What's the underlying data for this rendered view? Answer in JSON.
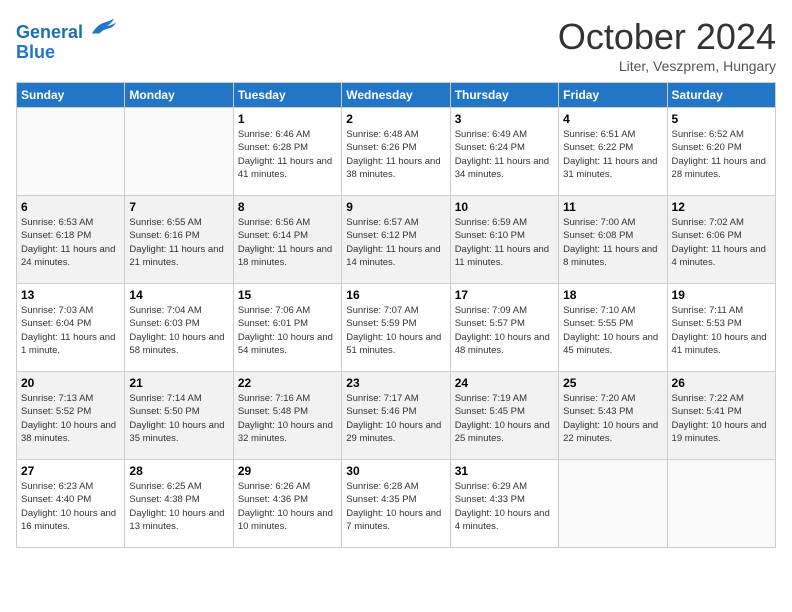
{
  "header": {
    "logo_line1": "General",
    "logo_line2": "Blue",
    "month_title": "October 2024",
    "subtitle": "Liter, Veszprem, Hungary"
  },
  "weekdays": [
    "Sunday",
    "Monday",
    "Tuesday",
    "Wednesday",
    "Thursday",
    "Friday",
    "Saturday"
  ],
  "weeks": [
    [
      {
        "day": "",
        "info": ""
      },
      {
        "day": "",
        "info": ""
      },
      {
        "day": "1",
        "info": "Sunrise: 6:46 AM\nSunset: 6:28 PM\nDaylight: 11 hours and 41 minutes."
      },
      {
        "day": "2",
        "info": "Sunrise: 6:48 AM\nSunset: 6:26 PM\nDaylight: 11 hours and 38 minutes."
      },
      {
        "day": "3",
        "info": "Sunrise: 6:49 AM\nSunset: 6:24 PM\nDaylight: 11 hours and 34 minutes."
      },
      {
        "day": "4",
        "info": "Sunrise: 6:51 AM\nSunset: 6:22 PM\nDaylight: 11 hours and 31 minutes."
      },
      {
        "day": "5",
        "info": "Sunrise: 6:52 AM\nSunset: 6:20 PM\nDaylight: 11 hours and 28 minutes."
      }
    ],
    [
      {
        "day": "6",
        "info": "Sunrise: 6:53 AM\nSunset: 6:18 PM\nDaylight: 11 hours and 24 minutes."
      },
      {
        "day": "7",
        "info": "Sunrise: 6:55 AM\nSunset: 6:16 PM\nDaylight: 11 hours and 21 minutes."
      },
      {
        "day": "8",
        "info": "Sunrise: 6:56 AM\nSunset: 6:14 PM\nDaylight: 11 hours and 18 minutes."
      },
      {
        "day": "9",
        "info": "Sunrise: 6:57 AM\nSunset: 6:12 PM\nDaylight: 11 hours and 14 minutes."
      },
      {
        "day": "10",
        "info": "Sunrise: 6:59 AM\nSunset: 6:10 PM\nDaylight: 11 hours and 11 minutes."
      },
      {
        "day": "11",
        "info": "Sunrise: 7:00 AM\nSunset: 6:08 PM\nDaylight: 11 hours and 8 minutes."
      },
      {
        "day": "12",
        "info": "Sunrise: 7:02 AM\nSunset: 6:06 PM\nDaylight: 11 hours and 4 minutes."
      }
    ],
    [
      {
        "day": "13",
        "info": "Sunrise: 7:03 AM\nSunset: 6:04 PM\nDaylight: 11 hours and 1 minute."
      },
      {
        "day": "14",
        "info": "Sunrise: 7:04 AM\nSunset: 6:03 PM\nDaylight: 10 hours and 58 minutes."
      },
      {
        "day": "15",
        "info": "Sunrise: 7:06 AM\nSunset: 6:01 PM\nDaylight: 10 hours and 54 minutes."
      },
      {
        "day": "16",
        "info": "Sunrise: 7:07 AM\nSunset: 5:59 PM\nDaylight: 10 hours and 51 minutes."
      },
      {
        "day": "17",
        "info": "Sunrise: 7:09 AM\nSunset: 5:57 PM\nDaylight: 10 hours and 48 minutes."
      },
      {
        "day": "18",
        "info": "Sunrise: 7:10 AM\nSunset: 5:55 PM\nDaylight: 10 hours and 45 minutes."
      },
      {
        "day": "19",
        "info": "Sunrise: 7:11 AM\nSunset: 5:53 PM\nDaylight: 10 hours and 41 minutes."
      }
    ],
    [
      {
        "day": "20",
        "info": "Sunrise: 7:13 AM\nSunset: 5:52 PM\nDaylight: 10 hours and 38 minutes."
      },
      {
        "day": "21",
        "info": "Sunrise: 7:14 AM\nSunset: 5:50 PM\nDaylight: 10 hours and 35 minutes."
      },
      {
        "day": "22",
        "info": "Sunrise: 7:16 AM\nSunset: 5:48 PM\nDaylight: 10 hours and 32 minutes."
      },
      {
        "day": "23",
        "info": "Sunrise: 7:17 AM\nSunset: 5:46 PM\nDaylight: 10 hours and 29 minutes."
      },
      {
        "day": "24",
        "info": "Sunrise: 7:19 AM\nSunset: 5:45 PM\nDaylight: 10 hours and 25 minutes."
      },
      {
        "day": "25",
        "info": "Sunrise: 7:20 AM\nSunset: 5:43 PM\nDaylight: 10 hours and 22 minutes."
      },
      {
        "day": "26",
        "info": "Sunrise: 7:22 AM\nSunset: 5:41 PM\nDaylight: 10 hours and 19 minutes."
      }
    ],
    [
      {
        "day": "27",
        "info": "Sunrise: 6:23 AM\nSunset: 4:40 PM\nDaylight: 10 hours and 16 minutes."
      },
      {
        "day": "28",
        "info": "Sunrise: 6:25 AM\nSunset: 4:38 PM\nDaylight: 10 hours and 13 minutes."
      },
      {
        "day": "29",
        "info": "Sunrise: 6:26 AM\nSunset: 4:36 PM\nDaylight: 10 hours and 10 minutes."
      },
      {
        "day": "30",
        "info": "Sunrise: 6:28 AM\nSunset: 4:35 PM\nDaylight: 10 hours and 7 minutes."
      },
      {
        "day": "31",
        "info": "Sunrise: 6:29 AM\nSunset: 4:33 PM\nDaylight: 10 hours and 4 minutes."
      },
      {
        "day": "",
        "info": ""
      },
      {
        "day": "",
        "info": ""
      }
    ]
  ]
}
